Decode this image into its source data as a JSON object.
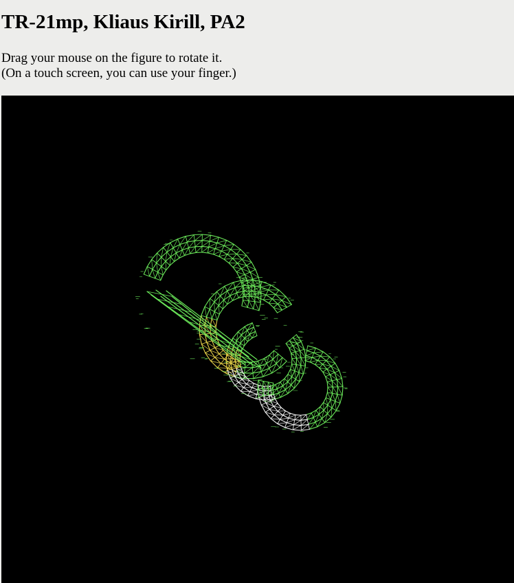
{
  "page": {
    "title": "TR-21mp, Kliaus Kirill, PA2",
    "instructions": [
      "Drag your mouse on the figure to rotate it.",
      "(On a touch screen, you can use your finger.)"
    ]
  },
  "viewer": {
    "background_color": "#000000",
    "colors": {
      "green": "#6be85a",
      "yellow": "#e8d34a",
      "white": "#f2f2f2"
    }
  }
}
